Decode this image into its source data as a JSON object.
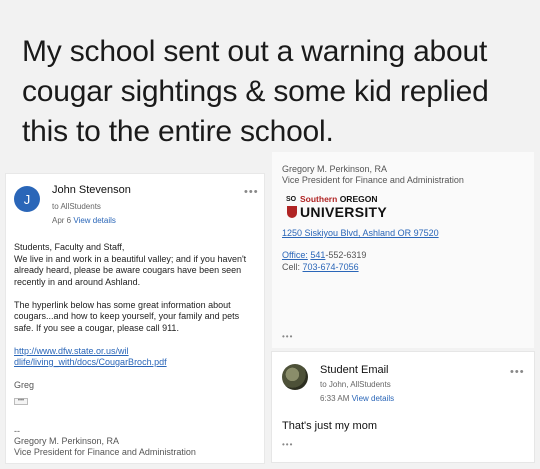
{
  "caption": {
    "lines": [
      "My school sent out a warning about",
      "cougar sightings & some kid replied",
      "this to the entire school."
    ]
  },
  "left_email": {
    "avatar_letter": "J",
    "sender": "John Stevenson",
    "to": "to AllStudents",
    "date": "Apr 6",
    "view_details": "View details",
    "more": "•••",
    "paragraphs": [
      "Students, Faculty and Staff,",
      "We live in and work in a beautiful valley; and if you haven't already heard, please be aware cougars have been seen recently in and around Ashland.",
      "The hyperlink below has some great information about cougars...and how to keep yourself, your family and pets safe.  If you see a cougar, please call 911."
    ],
    "link_line1": "http://www.dfw.state.or.us/wil",
    "link_line2": "dlife/living_with/docs/CougarBroch.pdf",
    "sign": "Greg",
    "collapse": "•••",
    "sig_dash": "--",
    "sig_name": "Gregory M. Perkinson, RA",
    "sig_title": "Vice President for Finance and Administration"
  },
  "signature_card": {
    "name": "Gregory M. Perkinson, RA",
    "title": "Vice President for Finance and Administration",
    "logo_seal": "SO",
    "logo_southern": "Southern",
    "logo_oregon": "OREGON",
    "logo_university": "UNIVERSITY",
    "address": "1250 Siskiyou Blvd, Ashland OR 97520",
    "office_label": "Office:",
    "office_link": "541",
    "office_rest": "-552-6319",
    "cell_label": "Cell:",
    "cell_number": "703-674-7056",
    "more": "•••"
  },
  "reply_email": {
    "sender": "Student Email",
    "to": "to John, AllStudents",
    "time": "6:33 AM",
    "view_details": "View details",
    "more": "•••",
    "message": "That's just my mom",
    "collapse": "•••"
  },
  "colors": {
    "link": "#2a66b8",
    "avatar": "#2a66b8",
    "brand_red": "#b02424"
  }
}
